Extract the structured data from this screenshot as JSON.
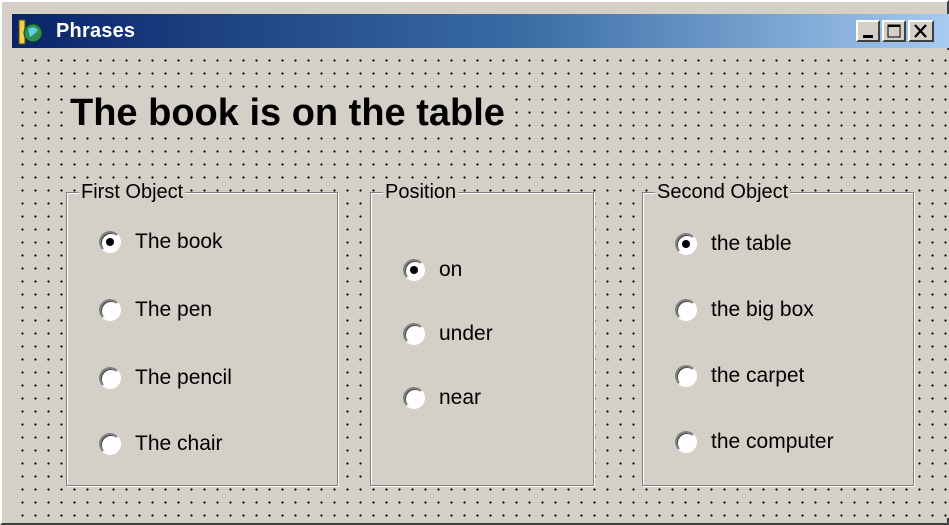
{
  "window": {
    "title": "Phrases"
  },
  "phrase": "The book is on the table",
  "groups": {
    "first": {
      "title": "First Object",
      "options": [
        "The book",
        "The pen",
        "The pencil",
        "The chair"
      ],
      "selected": 0
    },
    "position": {
      "title": "Position",
      "options": [
        "on",
        "under",
        "near"
      ],
      "selected": 0
    },
    "second": {
      "title": "Second Object",
      "options": [
        "the table",
        "the big box",
        "the carpet",
        "the computer"
      ],
      "selected": 0
    }
  },
  "icons": {
    "app": "app-icon",
    "minimize": "minimize-icon",
    "maximize": "maximize-icon",
    "close": "close-icon"
  }
}
